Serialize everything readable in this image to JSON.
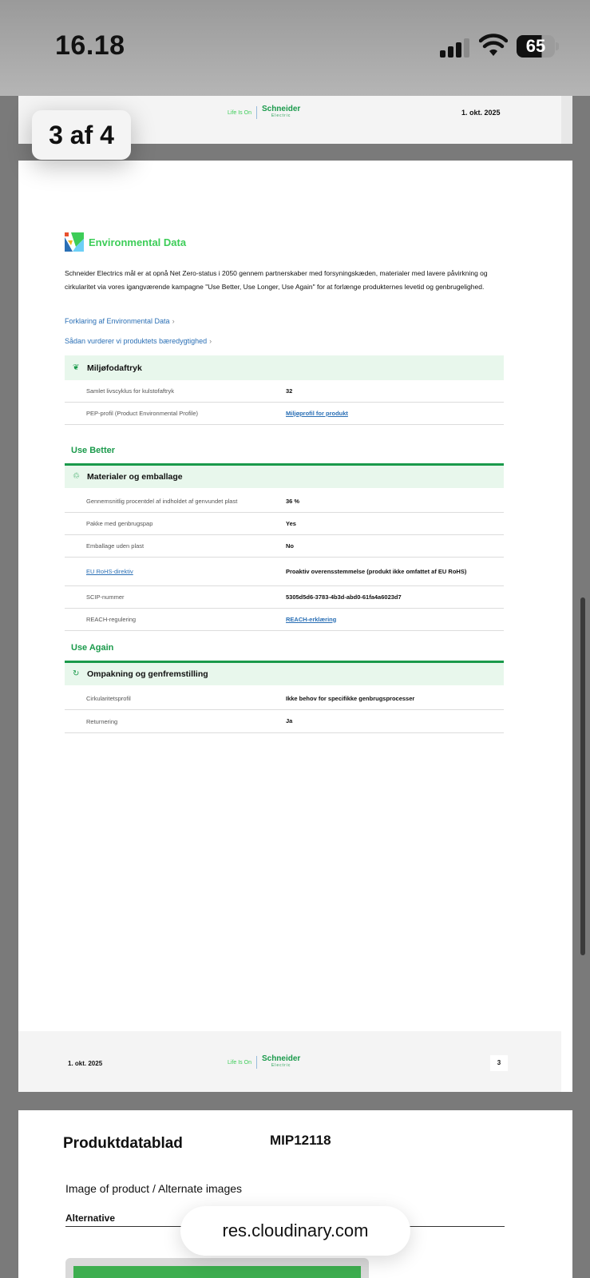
{
  "status_bar": {
    "time": "16.18",
    "battery": "65"
  },
  "page_indicator": "3 af 4",
  "brand": {
    "tagline": "Life Is On",
    "name": "Schneider",
    "sub": "Electric",
    "color": "#3dcd58"
  },
  "prev_page": {
    "date": "1. okt. 2025"
  },
  "environmental": {
    "title": "Environmental Data",
    "intro": "Schneider Electrics mål er at opnå Net Zero-status i 2050 gennem partnerskaber med forsyningskæden, materialer med lavere påvirkning og cirkularitet via vores igangværende kampagne \"Use Better, Use Longer, Use Again\" for at forlænge produkternes levetid og genbrugelighed.",
    "link1": "Forklaring af Environmental Data",
    "link2": "Sådan vurderer vi produktets bæredygtighed"
  },
  "footprint": {
    "title": "Miljøfodaftryk",
    "rows": [
      {
        "key": "Samlet livscyklus for kulstofaftryk",
        "value": "32"
      },
      {
        "key": "PEP-profil (Product Environmental Profile)",
        "value": "Miljøprofil for produkt"
      }
    ]
  },
  "use_better": {
    "group": "Use Better",
    "title": "Materialer og emballage",
    "rows": [
      {
        "key": "Gennemsnitlig procentdel af indholdet af genvundet plast",
        "value": "36 %"
      },
      {
        "key": "Pakke med genbrugspap",
        "value": "Yes"
      },
      {
        "key": "Emballage uden plast",
        "value": "No"
      },
      {
        "key": "EU RoHS-direktiv",
        "value": "Proaktiv overensstemmelse (produkt ikke omfattet af EU RoHS)"
      },
      {
        "key": "SCIP-nummer",
        "value": "5305d5d6-3783-4b3d-abd0-61fa4a6023d7"
      },
      {
        "key": "REACH-regulering",
        "value": "REACH-erklæring"
      }
    ]
  },
  "use_again": {
    "group": "Use Again",
    "title": "Ompakning og genfremstilling",
    "rows": [
      {
        "key": "Cirkularitetsprofil",
        "value": "Ikke behov for specifikke genbrugsprocesser"
      },
      {
        "key": "Returnering",
        "value": "Ja"
      }
    ]
  },
  "footer": {
    "date": "1. okt. 2025",
    "page_number": "3"
  },
  "next_page": {
    "title": "Produktdatablad",
    "code": "MIP12118",
    "image_label": "Image of product / Alternate images",
    "alt_label": "Alternative"
  },
  "browser": {
    "url": "res.cloudinary.com"
  }
}
